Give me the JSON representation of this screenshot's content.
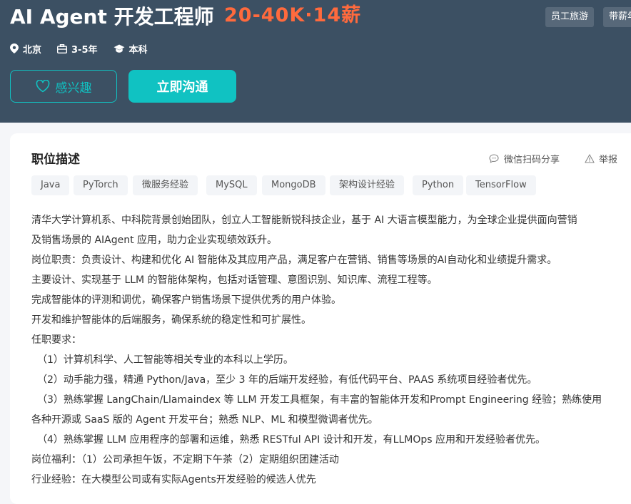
{
  "job": {
    "title": "AI Agent 开发工程师",
    "salary": "20-40K·14薪",
    "benefit_tags": [
      "员工旅游",
      "带薪年假"
    ],
    "city": "北京",
    "experience": "3-5年",
    "education": "本科"
  },
  "actions": {
    "interest_label": "感兴趣",
    "chat_label": "立即沟通"
  },
  "section": {
    "title": "职位描述",
    "share_label": "微信扫码分享",
    "report_label": "举报"
  },
  "skills": [
    "Java",
    "PyTorch",
    "微服务经验",
    "MySQL",
    "MongoDB",
    "架构设计经验",
    "Python",
    "TensorFlow"
  ],
  "description": [
    "清华大学计算机系、中科院背景创始团队，创立人工智能新锐科技企业，基于 AI 大语言模型能力，为全球企业提供面向营销",
    "及销售场景的 AIAgent 应用，助力企业实现绩效跃升。",
    "岗位职责：负责设计、构建和优化 AI 智能体及其应用产品，满足客户在营销、销售等场景的AI自动化和业绩提升需求。",
    "主要设计、实现基于 LLM 的智能体架构，包括对话管理、意图识别、知识库、流程工程等。",
    "完成智能体的评测和调优，确保客户销售场景下提供优秀的用户体验。",
    "开发和维护智能体的后端服务，确保系统的稳定性和可扩展性。",
    "任职要求：",
    "（1）计算机科学、人工智能等相关专业的本科以上学历。",
    "（2）动手能力强，精通 Python/Java，至少 3 年的后端开发经验，有低代码平台、PAAS 系统项目经验者优先。",
    "（3）熟练掌握 LangChain/Llamaindex 等 LLM 开发工具框架，有丰富的智能体开发和Prompt Engineering 经验；熟练使用",
    "各种开源或 SaaS 版的 Agent 开发平台；熟悉 NLP、ML 和模型微调者优先。",
    "（4）熟练掌握 LLM 应用程序的部署和运维，熟悉 RESTful API 设计和开发，有LLMOps 应用和开发经验者优先。",
    "岗位福利：（1）公司承担午饭，不定期下午茶（2）定期组织团建活动",
    "行业经验：在大模型公司或有实际Agents开发经验的候选人优先"
  ],
  "colors": {
    "header_bg": "#3c5063",
    "accent": "#10c2c2",
    "salary": "#ff6a3d"
  }
}
